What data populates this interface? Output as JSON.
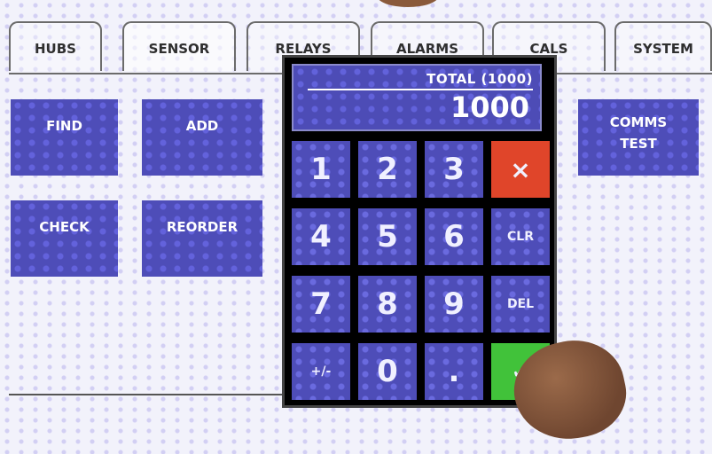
{
  "tabs": [
    "HUBS",
    "SENSOR",
    "RELAYS",
    "ALARMS",
    "CALS",
    "SYSTEM"
  ],
  "buttons": {
    "find": "FIND",
    "add": "ADD",
    "check": "CHECK",
    "reorder": "REORDER",
    "comms_line1": "COMMS",
    "comms_line2": "TEST"
  },
  "keypad": {
    "label": "TOTAL (1000)",
    "value": "1000",
    "keys": [
      "1",
      "2",
      "3",
      "×",
      "4",
      "5",
      "6",
      "CLR",
      "7",
      "8",
      "9",
      "DEL",
      "+/-",
      "0",
      ".",
      "✓"
    ]
  },
  "colors": {
    "button": "#4e4db8",
    "cancel": "#e0452a",
    "ok": "#41c23a",
    "panel": "#000000"
  }
}
